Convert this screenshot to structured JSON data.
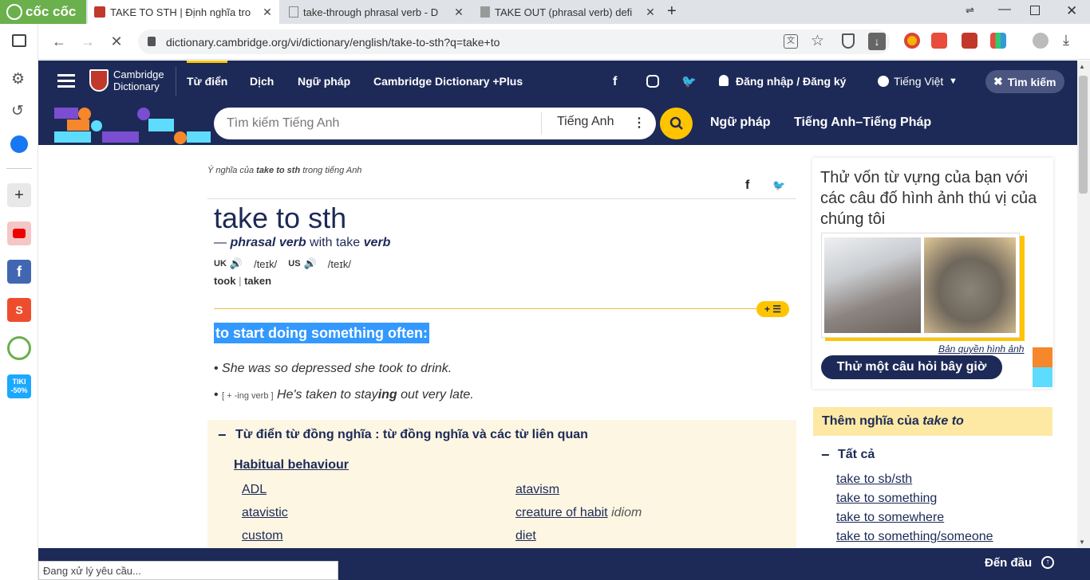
{
  "browser": {
    "brand": "cốc cốc",
    "tabs": [
      {
        "title": "TAKE TO STH | Định nghĩa tro",
        "active": true
      },
      {
        "title": "take-through phrasal verb - D",
        "active": false
      },
      {
        "title": "TAKE OUT (phrasal verb) defi",
        "active": false
      }
    ],
    "url": "dictionary.cambridge.org/vi/dictionary/english/take-to-sth?q=take+to"
  },
  "sidebar": {
    "tiki_line1": "TIKI",
    "tiki_line2": "-50%"
  },
  "header": {
    "logo_line1": "Cambridge",
    "logo_line2": "Dictionary",
    "nav": [
      "Từ điển",
      "Dịch",
      "Ngữ pháp",
      "Cambridge Dictionary +Plus"
    ],
    "login": "Đăng nhập / Đăng ký",
    "language": "Tiếng Việt",
    "search_toggle": "Tìm kiếm"
  },
  "search": {
    "placeholder": "Tìm kiếm Tiếng Anh",
    "language": "Tiếng Anh",
    "links": [
      "Ngữ pháp",
      "Tiếng Anh–Tiếng Pháp"
    ]
  },
  "entry": {
    "crumb_prefix": "Ý nghĩa của ",
    "crumb_word": "take to sth",
    "crumb_suffix": " trong tiếng Anh",
    "headword": "take to sth",
    "pos_dash": "— ",
    "pos": "phrasal verb",
    "pos_with": " with take ",
    "pos_verb": "verb",
    "uk_label": "UK",
    "uk_ipa": "/teɪk/",
    "us_label": "US",
    "us_ipa": "/teɪk/",
    "forms": [
      "took",
      "taken"
    ],
    "definition": "to start doing something often:",
    "example1": "She was so depressed she took to drink.",
    "example2_gram": "[ + -ing verb ]",
    "example2_a": " He's taken to stay",
    "example2_b": "ing",
    "example2_c": " out very late."
  },
  "thesaurus": {
    "title": "Từ điển từ đồng nghĩa : từ đồng nghĩa và các từ liên quan",
    "group": "Habitual behaviour",
    "left": [
      "ADL",
      "atavistic",
      "custom"
    ],
    "right_link0": "atavism",
    "right_link1": "creature of habit",
    "right_link1_tag": " idiom",
    "right_link2": "diet"
  },
  "quiz": {
    "title": "Thử vốn từ vựng của bạn với các câu đố hình ảnh thú vị của chúng tôi",
    "credit": "Bản quyền hình ảnh",
    "button": "Thử một câu hỏi bây giờ"
  },
  "more": {
    "heading_prefix": "Thêm nghĩa của ",
    "heading_word": "take to",
    "all_label": "Tất cả",
    "links": [
      "take to sb/sth",
      "take to something",
      "take to somewhere",
      "take to something/someone"
    ]
  },
  "footer": {
    "top_link": "Đến đầu",
    "status": "Đang xử lý yêu cầu..."
  },
  "colors": {
    "navy": "#1d2a57",
    "yellow": "#fec400",
    "highlight": "#3399ff",
    "thesaurus_bg": "#fdf6e3",
    "more_header_bg": "#fde9a4"
  }
}
